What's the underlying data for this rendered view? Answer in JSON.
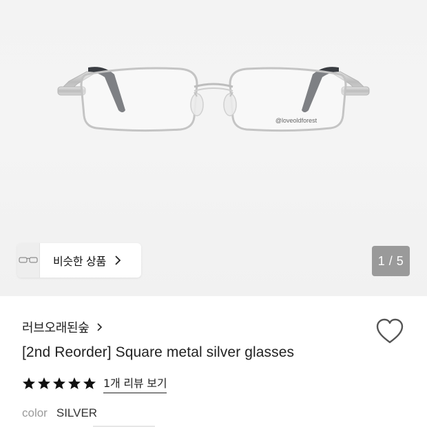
{
  "hero": {
    "glasses_imprint": "@loveoldforest",
    "similar_button_label": "비슷한 상품",
    "image_counter": "1 / 5"
  },
  "product": {
    "brand": "러브오래된숲",
    "title": "[2nd Reorder] Square metal silver glasses",
    "rating_stars": 5,
    "review_link": "1개 리뷰 보기",
    "color_label": "color",
    "color_value": "SILVER"
  },
  "icons": [
    "glasses-thumbnail-icon",
    "chevron-right-icon",
    "heart-icon",
    "star-icon"
  ],
  "colors": {
    "hero_bg": "#f3f3f3",
    "counter_bg": "#9a9a9a",
    "text_primary": "#222222",
    "text_muted": "#9a9a9a",
    "frame_silver": "#c9c9c9",
    "temple_dark": "#3a3d42"
  }
}
